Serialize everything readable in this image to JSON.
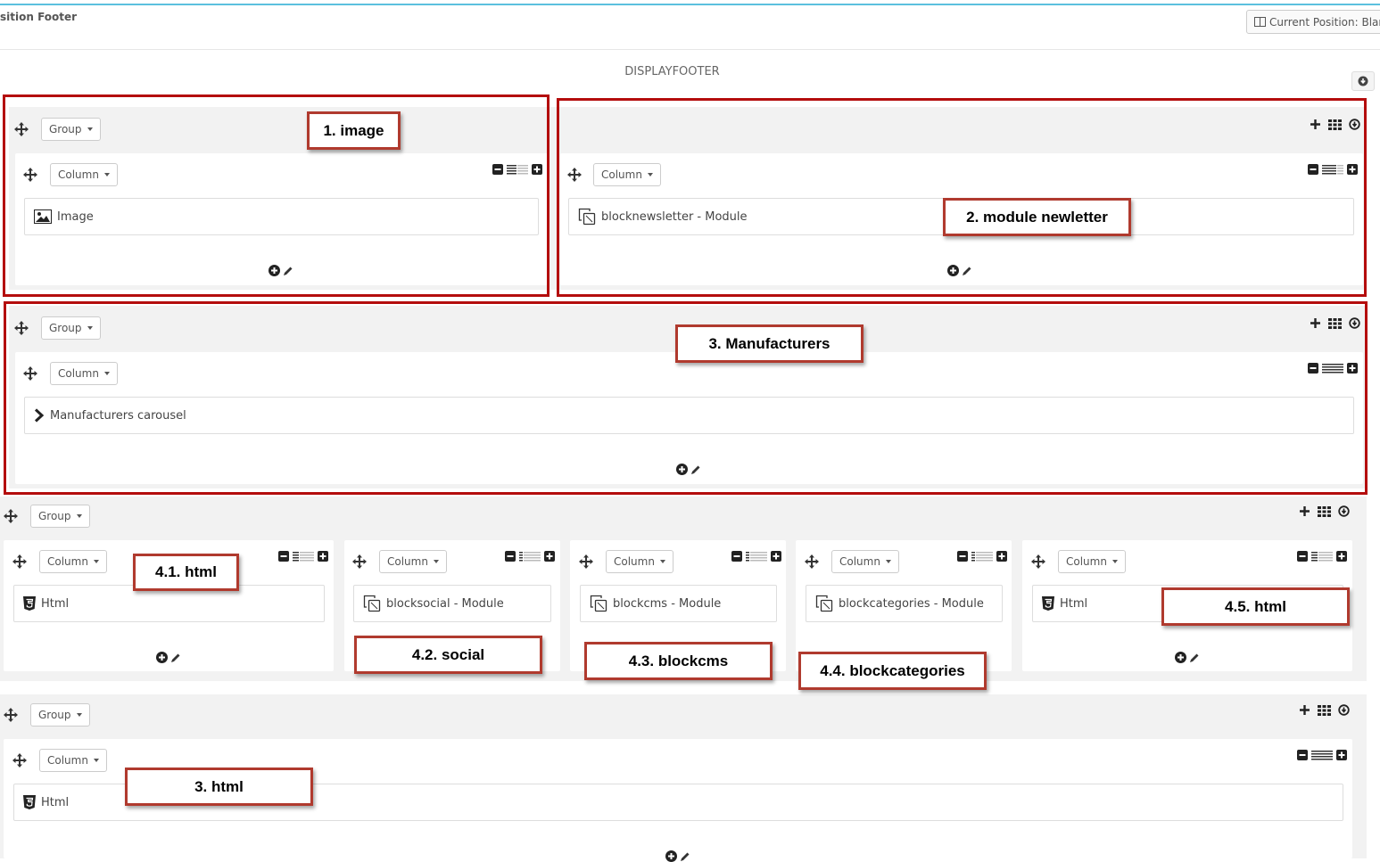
{
  "header": {
    "title": "sition Footer",
    "current_position": "Current Position: Blank"
  },
  "hook": {
    "name": "DISPLAYFOOTER"
  },
  "labels": {
    "group": "Group",
    "column": "Column"
  },
  "items": {
    "image": "Image",
    "newsletter": "blocknewsletter - Module",
    "manufacturers": "Manufacturers carousel",
    "html1": "Html",
    "social": "blocksocial - Module",
    "blockcms": "blockcms - Module",
    "blockcategories": "blockcategories - Module",
    "html5": "Html",
    "html_last": "Html"
  },
  "annotations": {
    "a1": "1. image",
    "a2": "2. module newletter",
    "a3": "3. Manufacturers",
    "a41": "4.1. html",
    "a42": "4.2. social",
    "a43": "4.3. blockcms",
    "a44": "4.4. blockcategories",
    "a45": "4.5. html",
    "a3b": "3. html"
  },
  "colors": {
    "accent_line": "#5bc0de",
    "highlight_border": "#b40d0d",
    "annotation_border": "#b03a2e"
  }
}
